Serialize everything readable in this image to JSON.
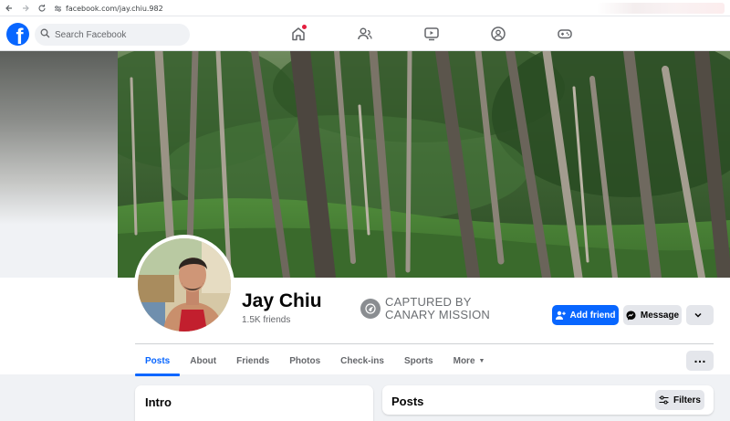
{
  "browser": {
    "url": "facebook.com/jay.chiu.982"
  },
  "topbar": {
    "logo": "f",
    "search_placeholder": "Search Facebook",
    "nav": [
      "home-icon",
      "friends-icon",
      "watch-icon",
      "groups-icon",
      "gaming-icon"
    ]
  },
  "profile": {
    "name": "Jay Chiu",
    "friends": "1.5K friends",
    "stamp_line1": "CAPTURED BY",
    "stamp_line2": "CANARY MISSION"
  },
  "actions": {
    "add_friend": "Add friend",
    "message": "Message",
    "more_menu": "…"
  },
  "tabs": [
    {
      "label": "Posts",
      "active": true
    },
    {
      "label": "About"
    },
    {
      "label": "Friends"
    },
    {
      "label": "Photos"
    },
    {
      "label": "Check-ins"
    },
    {
      "label": "Sports"
    },
    {
      "label": "More"
    }
  ],
  "intro": {
    "title": "Intro"
  },
  "posts": {
    "title": "Posts",
    "filters": "Filters"
  },
  "colors": {
    "brand": "#0866ff",
    "notification": "#e41e3f"
  }
}
